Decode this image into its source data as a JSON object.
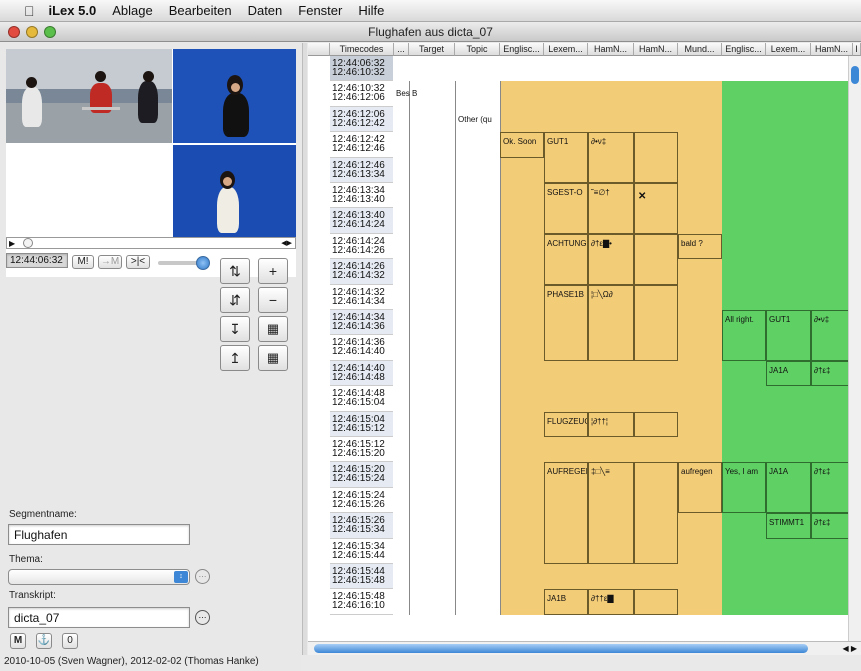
{
  "menubar": {
    "app": "iLex 5.0",
    "items": [
      "Ablage",
      "Bearbeiten",
      "Daten",
      "Fenster",
      "Hilfe"
    ]
  },
  "window": {
    "title": "Flughafen aus dicta_07"
  },
  "player": {
    "timecode": "12:44:06:32",
    "buttons": [
      "M!",
      "→M",
      ">|<"
    ]
  },
  "tools": {
    "plus": "+",
    "minus": "−"
  },
  "form": {
    "segment_label": "Segmentname:",
    "segment_value": "Flughafen",
    "thema_label": "Thema:",
    "transkript_label": "Transkript:",
    "transkript_value": "dicta_07",
    "mini_buttons": [
      "M",
      "⚓",
      "0"
    ]
  },
  "status": "2010-10-05 (Sven Wagner), 2012-02-02 (Thomas Hanke)",
  "columns": [
    {
      "label": "Timecodes"
    },
    {
      "label": "..."
    },
    {
      "label": "Target"
    },
    {
      "label": "Topic"
    },
    {
      "label": "Englisc..."
    },
    {
      "label": "Lexem..."
    },
    {
      "label": "HamN..."
    },
    {
      "label": "HamN..."
    },
    {
      "label": "Mund..."
    },
    {
      "label": "Englisc..."
    },
    {
      "label": "Lexem..."
    },
    {
      "label": "HamN..."
    },
    {
      "label": "I"
    }
  ],
  "rows": [
    {
      "t1": "12:44:06:32",
      "t2": "12:46:10:32"
    },
    {
      "t1": "12:46:10:32",
      "t2": "12:46:12:06"
    },
    {
      "t1": "12:46:12:06",
      "t2": "12:46:12:42"
    },
    {
      "t1": "12:46:12:42",
      "t2": "12:46:12:46"
    },
    {
      "t1": "12:46:12:46",
      "t2": "12:46:13:34"
    },
    {
      "t1": "12:46:13:34",
      "t2": "12:46:13:40"
    },
    {
      "t1": "12:46:13:40",
      "t2": "12:46:14:24"
    },
    {
      "t1": "12:46:14:24",
      "t2": "12:46:14:26"
    },
    {
      "t1": "12:46:14:26",
      "t2": "12:46:14:32"
    },
    {
      "t1": "12:46:14:32",
      "t2": "12:46:14:34"
    },
    {
      "t1": "12:46:14:34",
      "t2": "12:46:14:36"
    },
    {
      "t1": "12:46:14:36",
      "t2": "12:46:14:40"
    },
    {
      "t1": "12:46:14:40",
      "t2": "12:46:14:48"
    },
    {
      "t1": "12:46:14:48",
      "t2": "12:46:15:04"
    },
    {
      "t1": "12:46:15:04",
      "t2": "12:46:15:12"
    },
    {
      "t1": "12:46:15:12",
      "t2": "12:46:15:20"
    },
    {
      "t1": "12:46:15:20",
      "t2": "12:46:15:24"
    },
    {
      "t1": "12:46:15:24",
      "t2": "12:46:15:26"
    },
    {
      "t1": "12:46:15:26",
      "t2": "12:46:15:34"
    },
    {
      "t1": "12:46:15:34",
      "t2": "12:46:15:44"
    },
    {
      "t1": "12:46:15:44",
      "t2": "12:46:15:48"
    },
    {
      "t1": "12:46:15:48",
      "t2": "12:46:16:10"
    }
  ],
  "annotations": {
    "target": "Bes B",
    "topic": "Other (qu",
    "eng1": [
      "Ok. Soon"
    ],
    "lex1": [
      "GUT1",
      "SGEST-O",
      "ACHTUNG",
      "PHASE1B",
      "FLUGZEUG",
      "AUFREGEI",
      "JA1B"
    ],
    "ham1": [
      "∂•ν‡",
      "˜≡∅†",
      "∂†ε▇•",
      "¦□╲Ω∂",
      "¦∂††¦",
      "‡□╲≡",
      "∂††ε▇"
    ],
    "ham1_extra": "✕",
    "mund": [
      "bald ?",
      "aufregen"
    ],
    "eng2": [
      "All right.",
      "Yes, I am"
    ],
    "lex2": [
      "GUT1",
      "JA1A",
      "JA1A",
      "STIMMT1"
    ],
    "ham2": [
      "∂•ν‡",
      "∂†ε‡",
      "∂†ε‡",
      "∂†ε‡"
    ]
  },
  "colors": {
    "orange": "#f3cc78",
    "green": "#5fd164",
    "header": "#dcdcdc"
  }
}
